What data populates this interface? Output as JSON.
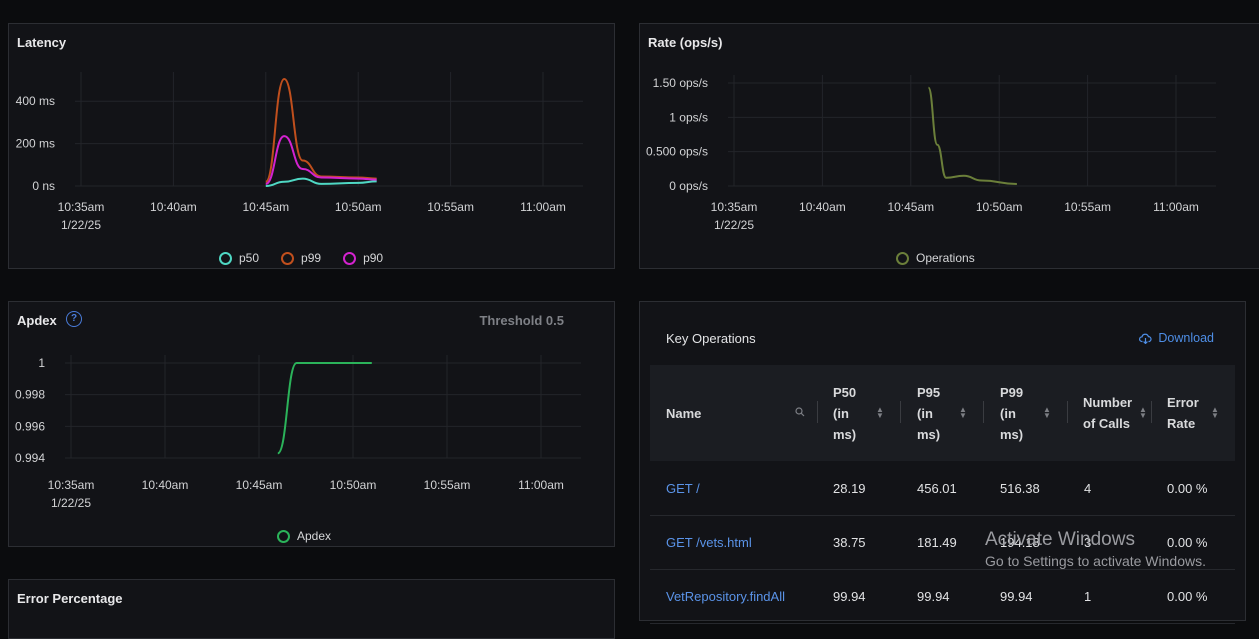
{
  "latency": {
    "title": "Latency",
    "y_ticks": [
      "400 ms",
      "200 ms",
      "0 ns"
    ],
    "x_ticks": [
      "10:35am",
      "10:40am",
      "10:45am",
      "10:50am",
      "10:55am",
      "11:00am"
    ],
    "x_date": "1/22/25",
    "legend": [
      "p50",
      "p99",
      "p90"
    ],
    "colors": {
      "p50": "#4fd8c4",
      "p99": "#c04f1d",
      "p90": "#d322cf"
    }
  },
  "rate": {
    "title": "Rate (ops/s)",
    "y_ticks": [
      "1.50 ops/s",
      "1 ops/s",
      "0.500 ops/s",
      "0 ops/s"
    ],
    "x_ticks": [
      "10:35am",
      "10:40am",
      "10:45am",
      "10:50am",
      "10:55am",
      "11:00am"
    ],
    "x_date": "1/22/25",
    "legend": [
      "Operations"
    ],
    "colors": {
      "Operations": "#6b7f3a"
    }
  },
  "apdex": {
    "title": "Apdex",
    "threshold": "Threshold 0.5",
    "y_ticks": [
      "1",
      "0.998",
      "0.996",
      "0.994"
    ],
    "x_ticks": [
      "10:35am",
      "10:40am",
      "10:45am",
      "10:50am",
      "10:55am",
      "11:00am"
    ],
    "x_date": "1/22/25",
    "legend": [
      "Apdex"
    ],
    "colors": {
      "Apdex": "#2bb35a"
    }
  },
  "error_percentage": {
    "title": "Error Percentage"
  },
  "key_operations": {
    "title": "Key Operations",
    "download_label": "Download",
    "columns": [
      {
        "l1": "Name",
        "l2": "",
        "l3": ""
      },
      {
        "l1": "P50",
        "l2": "(in",
        "l3": "ms)"
      },
      {
        "l1": "P95",
        "l2": "(in",
        "l3": "ms)"
      },
      {
        "l1": "P99",
        "l2": "(in",
        "l3": "ms)"
      },
      {
        "l1": "Number",
        "l2": "of Calls",
        "l3": ""
      },
      {
        "l1": "Error",
        "l2": "Rate",
        "l3": ""
      }
    ],
    "rows": [
      {
        "name": "GET /",
        "p50": "28.19",
        "p95": "456.01",
        "p99": "516.38",
        "calls": "4",
        "error": "0.00 %"
      },
      {
        "name": "GET /vets.html",
        "p50": "38.75",
        "p95": "181.49",
        "p99": "194.18",
        "calls": "3",
        "error": "0.00 %"
      },
      {
        "name": "VetRepository.findAll",
        "p50": "99.94",
        "p95": "99.94",
        "p99": "99.94",
        "calls": "1",
        "error": "0.00 %"
      }
    ]
  },
  "watermark": {
    "line1": "Activate Windows",
    "line2": "Go to Settings to activate Windows."
  },
  "chart_data": [
    {
      "type": "line",
      "title": "Latency",
      "x_ticks": [
        "10:35am",
        "10:40am",
        "10:45am",
        "10:50am",
        "10:55am",
        "11:00am"
      ],
      "series": [
        {
          "name": "p50",
          "x": [
            "10:45:00",
            "10:46:00",
            "10:47:00",
            "10:48:00",
            "10:50:00",
            "10:51:00"
          ],
          "values": [
            0,
            20,
            35,
            10,
            15,
            22
          ]
        },
        {
          "name": "p99",
          "x": [
            "10:45:00",
            "10:46:00",
            "10:47:00",
            "10:48:00",
            "10:50:00",
            "10:51:00"
          ],
          "values": [
            20,
            505,
            120,
            45,
            40,
            35
          ]
        },
        {
          "name": "p90",
          "x": [
            "10:45:00",
            "10:46:00",
            "10:47:00",
            "10:48:00",
            "10:50:00",
            "10:51:00"
          ],
          "values": [
            10,
            235,
            80,
            40,
            35,
            30
          ]
        }
      ],
      "ylim": [
        0,
        500
      ]
    },
    {
      "type": "line",
      "title": "Rate (ops/s)",
      "x_ticks": [
        "10:35am",
        "10:40am",
        "10:45am",
        "10:50am",
        "10:55am",
        "11:00am"
      ],
      "series": [
        {
          "name": "Operations",
          "x": [
            "10:46:00",
            "10:46:30",
            "10:47:00",
            "10:48:00",
            "10:49:00",
            "10:51:00"
          ],
          "values": [
            1.43,
            0.6,
            0.12,
            0.15,
            0.08,
            0.03
          ]
        }
      ],
      "ylim": [
        0,
        1.5
      ]
    },
    {
      "type": "line",
      "title": "Apdex",
      "x_ticks": [
        "10:35am",
        "10:40am",
        "10:45am",
        "10:50am",
        "10:55am",
        "11:00am"
      ],
      "series": [
        {
          "name": "Apdex",
          "x": [
            "10:46:00",
            "10:47:00",
            "10:48:00",
            "10:51:00"
          ],
          "values": [
            0.9943,
            1,
            1,
            1
          ]
        }
      ],
      "ylim": [
        0.994,
        1
      ]
    }
  ]
}
